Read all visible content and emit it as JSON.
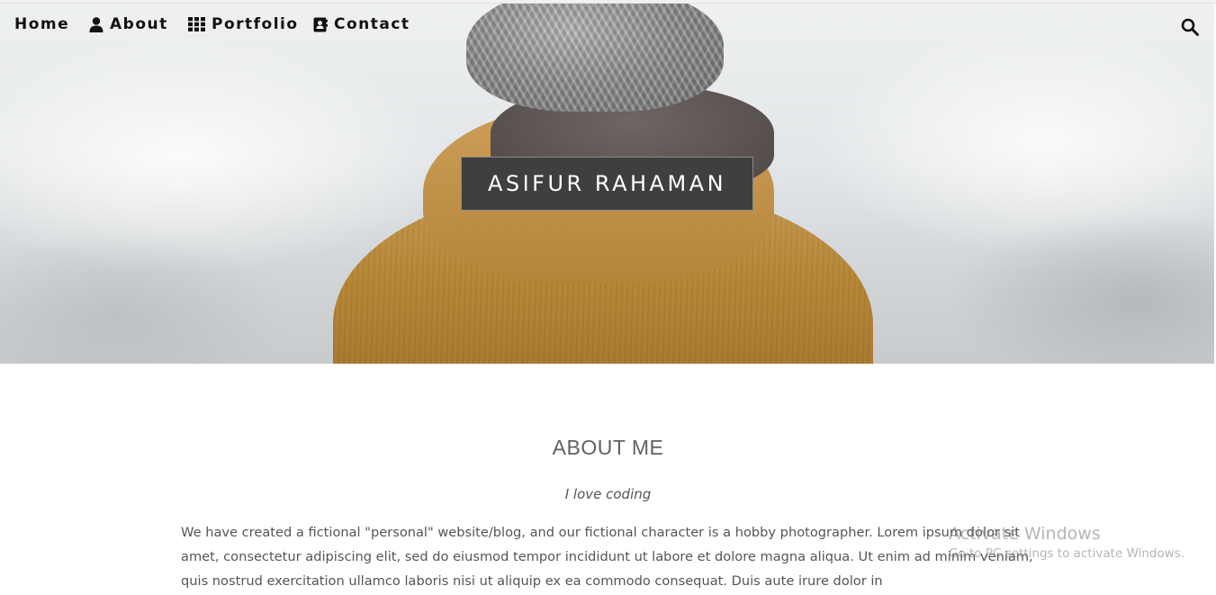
{
  "nav": {
    "items": [
      {
        "label": "Home",
        "icon": "none"
      },
      {
        "label": "About",
        "icon": "user-icon"
      },
      {
        "label": "Portfolio",
        "icon": "grid-icon"
      },
      {
        "label": "Contact",
        "icon": "address-book-icon"
      }
    ],
    "search_icon": "search-icon"
  },
  "hero": {
    "title": "ASIFUR RAHAMAN"
  },
  "about": {
    "heading": "ABOUT ME",
    "tagline": "I love coding",
    "paragraph": "We have created a fictional \"personal\" website/blog, and our fictional character is a hobby photographer. Lorem ipsum dolor sit amet, consectetur adipiscing elit, sed do eiusmod tempor incididunt ut labore et dolore magna aliqua. Ut enim ad minim veniam, quis nostrud exercitation ullamco laboris nisi ut aliquip ex ea commodo consequat. Duis aute irure dolor in"
  },
  "watermark": {
    "title": "Activate Windows",
    "subtitle": "Go to PC settings to activate Windows."
  },
  "colors": {
    "title_box_bg": "#3f3f3f",
    "nav_text": "#111111",
    "body_text": "#555555"
  }
}
